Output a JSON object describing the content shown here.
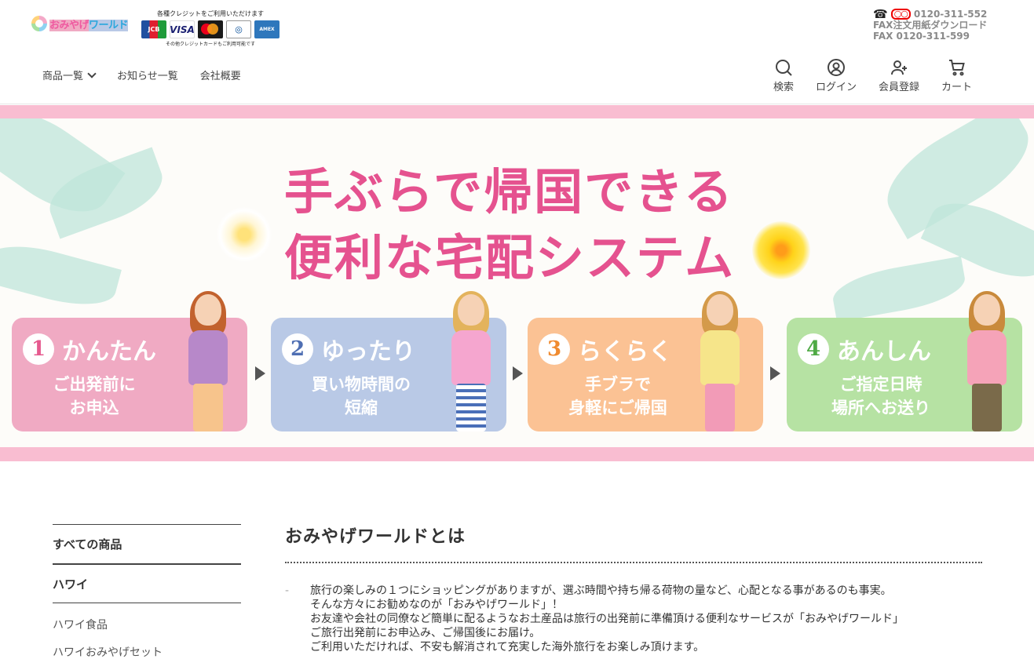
{
  "logo": {
    "part1": "おみやげ",
    "part2": "ワールド"
  },
  "credit": {
    "top": "各種クレジットをご利用いただけます",
    "cards": [
      "JCB",
      "VISA",
      "mastercard",
      "Diners Club",
      "AMERICAN EXPRESS"
    ],
    "bottom": "その他クレジットカードもご利用可能です"
  },
  "contact": {
    "phone": "0120-311-552",
    "fax_download": "FAX注文用紙ダウンロード",
    "fax": "FAX 0120-311-599"
  },
  "nav": {
    "products": "商品一覧",
    "news": "お知らせ一覧",
    "company": "会社概要"
  },
  "utils": {
    "search": "検索",
    "login": "ログイン",
    "register": "会員登録",
    "cart": "カート"
  },
  "hero": {
    "title_line1": "手ぶらで帰国できる",
    "title_line2": "便利な宅配システム",
    "steps": [
      {
        "num": "1",
        "title": "かんたん",
        "line1": "ご出発前に",
        "line2": "お申込"
      },
      {
        "num": "2",
        "title": "ゆったり",
        "line1": "買い物時間の",
        "line2": "短縮"
      },
      {
        "num": "3",
        "title": "らくらく",
        "line1": "手ブラで",
        "line2": "身軽にご帰国"
      },
      {
        "num": "4",
        "title": "あんしん",
        "line1": "ご指定日時",
        "line2": "場所へお送り"
      }
    ]
  },
  "colors": {
    "accent_pink": "#e5528f",
    "band_pink": "#f9bdd1",
    "panel1": "#f0aac3",
    "panel2": "#b9c9e6",
    "panel3": "#fbc294",
    "panel4": "#b6e2a3"
  },
  "sidebar": {
    "all": "すべての商品",
    "hawaii": "ハワイ",
    "items": [
      "ハワイ食品",
      "ハワイおみやげセット"
    ]
  },
  "main": {
    "title": "おみやげワールドとは",
    "bullet": "-",
    "lines": [
      "旅行の楽しみの１つにショッピングがありますが、選ぶ時間や持ち帰る荷物の量など、心配となる事があるのも事実。",
      "そんな方々にお勧めなのが「おみやげワールド」！",
      "お友達や会社の同僚など簡単に配るようなお土産品は旅行の出発前に準備頂ける便利なサービスが「おみやげワールド」",
      "ご旅行出発前にお申込み、ご帰国後にお届け。",
      "ご利用いただければ、不安も解消されて充実した海外旅行をお楽しみ頂けます。"
    ]
  }
}
